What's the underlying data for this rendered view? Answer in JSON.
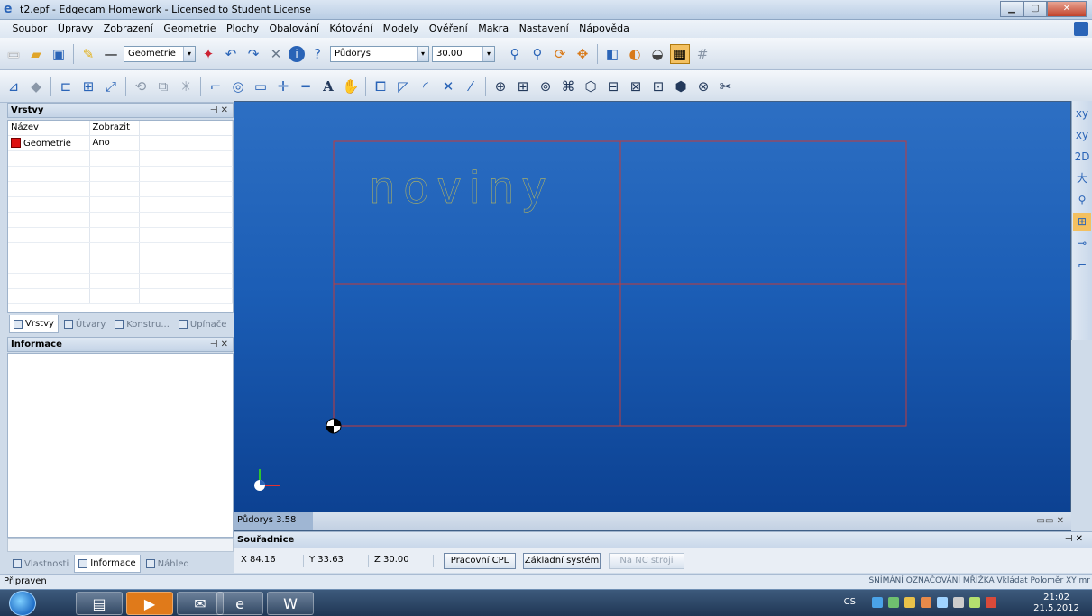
{
  "window": {
    "title": "t2.epf - Edgecam Homework - Licensed to Student License"
  },
  "menu": [
    "Soubor",
    "Úpravy",
    "Zobrazení",
    "Geometrie",
    "Plochy",
    "Obalování",
    "Kótování",
    "Modely",
    "Ověření",
    "Makra",
    "Nastavení",
    "Nápověda"
  ],
  "toolbar": {
    "geometry_combo": "Geometrie",
    "view_combo": "Půdorys",
    "zoom_combo": "30.00"
  },
  "layers_panel": {
    "title": "Vrstvy",
    "columns": [
      "Název",
      "Zobrazit"
    ],
    "rows": [
      {
        "name": "Geometrie",
        "show": "Ano"
      }
    ]
  },
  "left_tabs_top": [
    "Vrstvy",
    "Útvary",
    "Konstru...",
    "Upínače"
  ],
  "info_panel": {
    "title": "Informace"
  },
  "left_tabs_bottom": [
    "Vlastnosti",
    "Informace",
    "Náhled"
  ],
  "viewport": {
    "text": "noviny",
    "view_label": "Půdorys 3.58",
    "colors": {
      "background": "#1b5db5",
      "grid_line": "#c23b3b",
      "text": "#d9c948"
    }
  },
  "coordinates": {
    "title": "Souřadnice",
    "x": "X 84.16",
    "y": "Y 33.63",
    "z": "Z 30.00",
    "btn_cpl": "Pracovní CPL",
    "btn_base": "Základní systém",
    "btn_nc": "Na NC stroji"
  },
  "status": {
    "text": "Připraven",
    "right": "SNÍMÁNÍ OZNAČOVÁNÍ MŘÍŽKA Vkládat Poloměr XY mr"
  },
  "taskbar": {
    "lang": "CS",
    "time": "21:02",
    "date": "21.5.2012"
  }
}
